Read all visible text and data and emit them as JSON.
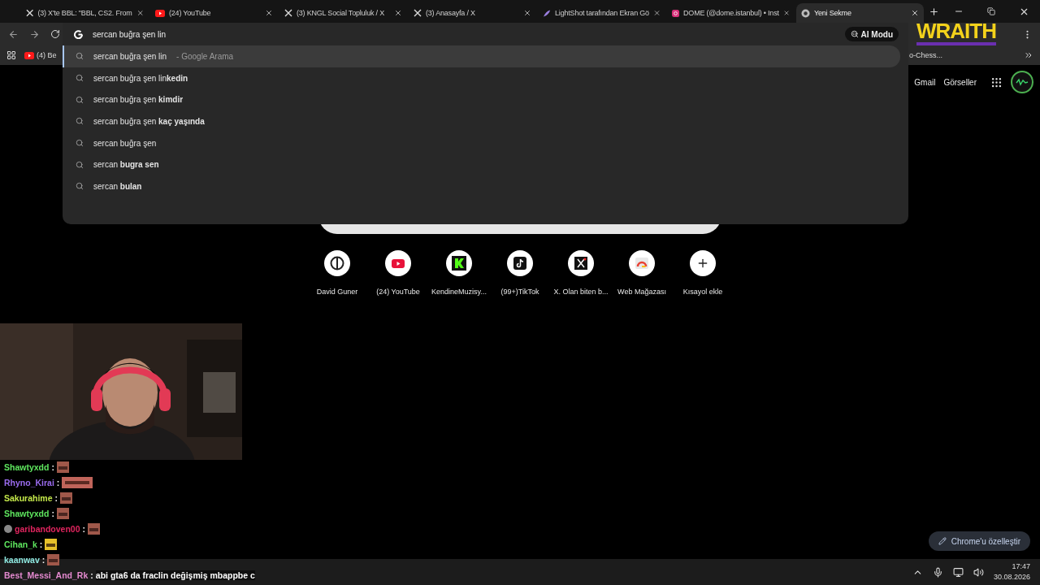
{
  "tabs": [
    {
      "title": "(3) X'te BBL: \"BBL, CS2. From",
      "kind": "x",
      "selected": false
    },
    {
      "title": "(24) YouTube",
      "kind": "youtube",
      "selected": false
    },
    {
      "title": "(3) KNGL Social Topluluk / X",
      "kind": "x",
      "selected": false
    },
    {
      "title": "(3) Anasayfa / X",
      "kind": "x",
      "selected": false
    },
    {
      "title": "LightShot tarafından Ekran Gö",
      "kind": "feather",
      "selected": false
    },
    {
      "title": "DOME (@dome.istanbul) • Inst",
      "kind": "instagram",
      "selected": false
    },
    {
      "title": "Yeni Sekme",
      "kind": "chrome",
      "selected": true
    }
  ],
  "omnibox": {
    "value": "sercan buğra şen lin",
    "ai_mode": "AI Modu"
  },
  "suggestions": [
    {
      "text": "sercan buğra şen lin",
      "source": "- Google Arama",
      "selected": true
    },
    {
      "text": "sercan buğra şen lin**kedin**",
      "selected": false
    },
    {
      "text": "sercan buğra şen **kimdir**",
      "selected": false
    },
    {
      "text": "sercan buğra şen **kaç yaşında**",
      "selected": false
    },
    {
      "text": "sercan buğra şen",
      "selected": false
    },
    {
      "text": "sercan **bugra sen**",
      "selected": false
    },
    {
      "text": "sercan **bulan**",
      "selected": false
    }
  ],
  "bookmarks": [
    {
      "title": "(4) Be",
      "kind": "youtube"
    },
    {
      "title": "o-Chess...",
      "kind": "plain"
    }
  ],
  "overlay_logo": "WRAITH",
  "header_links": [
    "Gmail",
    "Görseller"
  ],
  "shortcuts": [
    {
      "label": "David Guner",
      "kind": "monogram"
    },
    {
      "label": "(24) YouTube",
      "kind": "youtube"
    },
    {
      "label": "KendineMuzisy...",
      "kind": "k"
    },
    {
      "label": "(99+)TikTok",
      "kind": "tiktok"
    },
    {
      "label": "X. Olan biten b...",
      "kind": "x"
    },
    {
      "label": "Web Mağazası",
      "kind": "webstore"
    },
    {
      "label": "Kısayol ekle",
      "kind": "plus"
    }
  ],
  "chat": [
    {
      "user": "Shawtyxdd",
      "sep": ":",
      "color": "#5ee65e",
      "kind": "face"
    },
    {
      "user": "Rhyno_Kirai",
      "sep": ":",
      "color": "#9b6cf0",
      "kind": "wide"
    },
    {
      "user": "Sakurahime",
      "sep": ":",
      "color": "#c4e84a",
      "kind": "face"
    },
    {
      "user": "Shawtyxdd",
      "sep": ":",
      "color": "#5ee65e",
      "kind": "face"
    },
    {
      "user": "garibandoven00",
      "sep": ":",
      "color": "#e0245e",
      "kind": "face",
      "badge": true
    },
    {
      "user": "Cihan_k",
      "sep": ":",
      "color": "#5ee65e",
      "kind": "gold"
    },
    {
      "user": "kaanwav",
      "sep": ":",
      "color": "#8ee8e0",
      "kind": "face"
    },
    {
      "user": "Best_Messi_And_Rk",
      "sep": ":",
      "color": "#e58ad0",
      "kind": "message",
      "message": "abi gta6 da fraclin değişmiş mbappbe c"
    }
  ],
  "customize_button": "Chrome'u özelleştir",
  "clock": {
    "time": "17:47",
    "date": "30.08.2026"
  }
}
